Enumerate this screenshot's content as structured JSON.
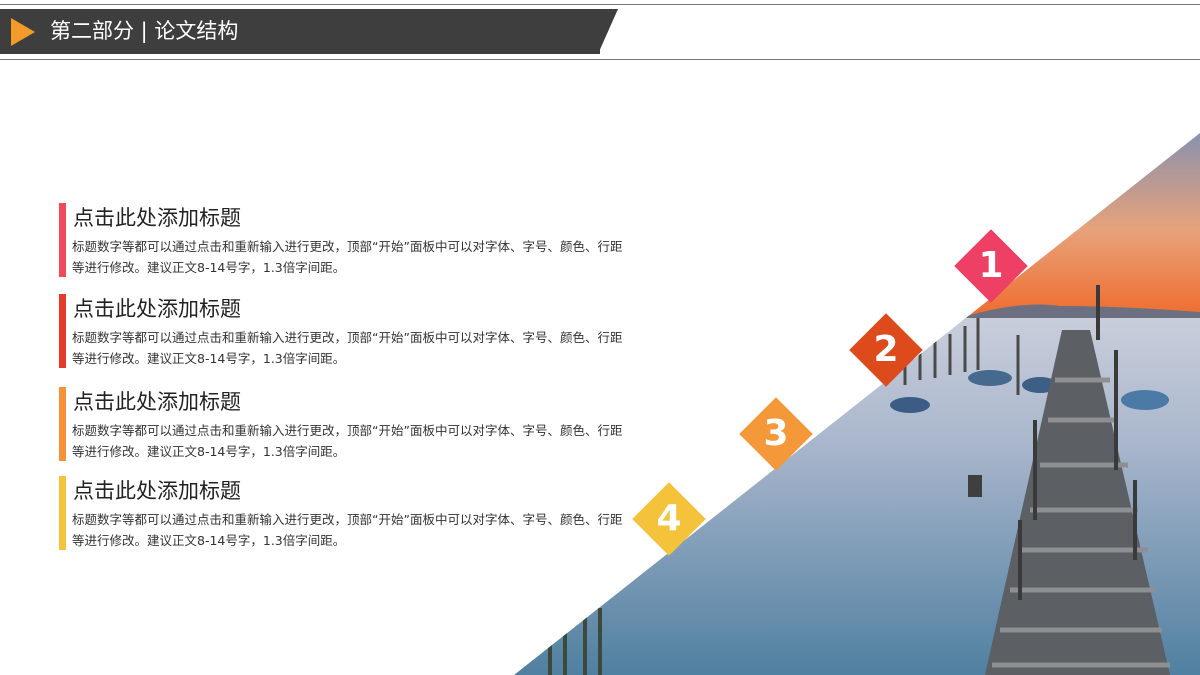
{
  "header": {
    "title": "第二部分 | 论文结构",
    "bar_color": "#3e3e3e",
    "arrow_color": "#f29b2a"
  },
  "items": [
    {
      "title": "点击此处添加标题",
      "desc": "标题数字等都可以通过点击和重新输入进行更改，顶部“开始”面板中可以对字体、字号、颜色、行距等进行修改。建议正文8-14号字，1.3倍字间距。",
      "color": "#f04a5d"
    },
    {
      "title": "点击此处添加标题",
      "desc": "标题数字等都可以通过点击和重新输入进行更改，顶部“开始”面板中可以对字体、字号、颜色、行距等进行修改。建议正文8-14号字，1.3倍字间距。",
      "color": "#e63a2a"
    },
    {
      "title": "点击此处添加标题",
      "desc": "标题数字等都可以通过点击和重新输入进行更改，顶部“开始”面板中可以对字体、字号、颜色、行距等进行修改。建议正文8-14号字，1.3倍字间距。",
      "color": "#f7923a"
    },
    {
      "title": "点击此处添加标题",
      "desc": "标题数字等都可以通过点击和重新输入进行更改，顶部“开始”面板中可以对字体、字号、颜色、行距等进行修改。建议正文8-14号字，1.3倍字间距。",
      "color": "#f3c33a"
    }
  ],
  "badges": [
    {
      "num": "1",
      "color": "#ee3f64"
    },
    {
      "num": "2",
      "color": "#dd4a1c"
    },
    {
      "num": "3",
      "color": "#f5983a"
    },
    {
      "num": "4",
      "color": "#f4c23b"
    }
  ]
}
